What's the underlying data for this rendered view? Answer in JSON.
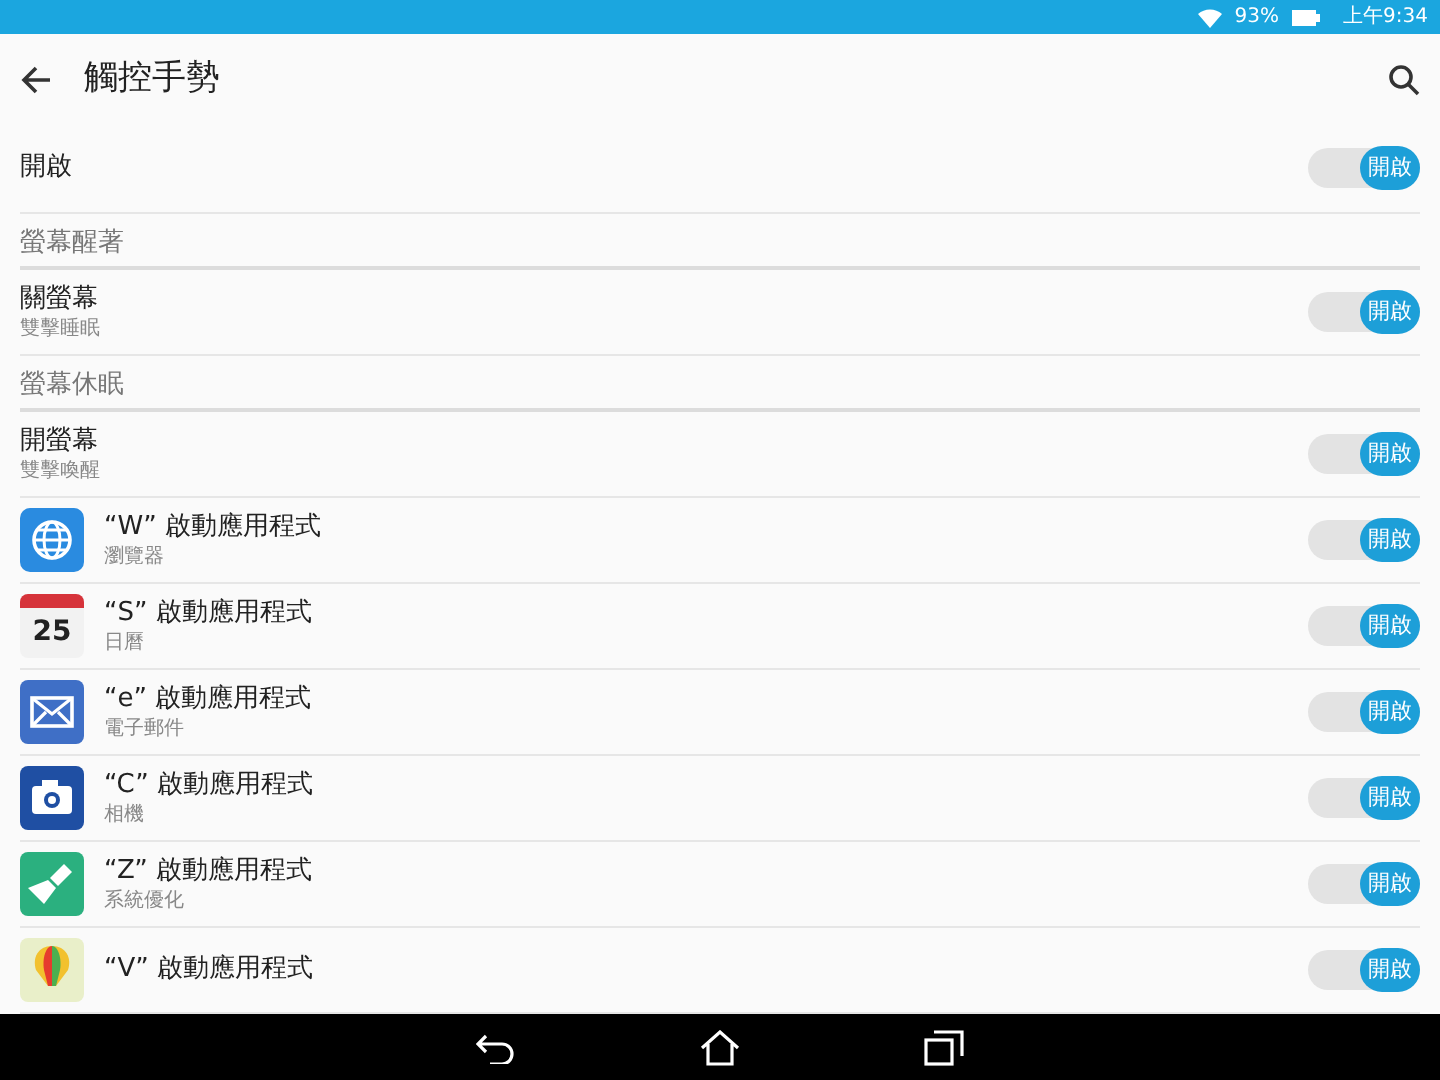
{
  "status_bar": {
    "battery": "93%",
    "time": "上午9:34"
  },
  "toolbar": {
    "title": "觸控手勢"
  },
  "items": [
    {
      "kind": "setting",
      "title": "開啟",
      "toggle": {
        "on": true,
        "label": "開啟"
      }
    },
    {
      "kind": "header",
      "title": "螢幕醒著"
    },
    {
      "kind": "setting",
      "title": "關螢幕",
      "subtitle": "雙擊睡眠",
      "toggle": {
        "on": true,
        "label": "開啟"
      }
    },
    {
      "kind": "header",
      "title": "螢幕休眠"
    },
    {
      "kind": "setting",
      "title": "開螢幕",
      "subtitle": "雙擊喚醒",
      "toggle": {
        "on": true,
        "label": "開啟"
      }
    },
    {
      "kind": "app",
      "title": "“W” 啟動應用程式",
      "subtitle": "瀏覽器",
      "toggle": {
        "on": true,
        "label": "開啟"
      }
    },
    {
      "kind": "app",
      "icon_text": "25",
      "title": "“S” 啟動應用程式",
      "subtitle": "日曆",
      "toggle": {
        "on": true,
        "label": "開啟"
      }
    },
    {
      "kind": "app",
      "title": "“e” 啟動應用程式",
      "subtitle": "電子郵件",
      "toggle": {
        "on": true,
        "label": "開啟"
      }
    },
    {
      "kind": "app",
      "title": "“C” 啟動應用程式",
      "subtitle": "相機",
      "toggle": {
        "on": true,
        "label": "開啟"
      }
    },
    {
      "kind": "app",
      "title": "“Z” 啟動應用程式",
      "subtitle": "系統優化",
      "toggle": {
        "on": true,
        "label": "開啟"
      }
    },
    {
      "kind": "app",
      "title": "“V” 啟動應用程式",
      "toggle": {
        "on": true,
        "label": "開啟"
      }
    }
  ]
}
